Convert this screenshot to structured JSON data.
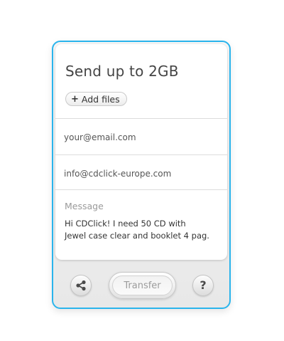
{
  "panel": {
    "title": "Send up to 2GB",
    "add_files_label": "Add files",
    "add_files_icon": "plus-icon"
  },
  "form": {
    "to_email_placeholder": "your@email.com",
    "from_email_value": "info@cdclick-europe.com",
    "message_label": "Message",
    "message_lines": [
      "Hi CDClick! I need 50 CD with",
      "Jewel case clear and booklet 4 pag."
    ]
  },
  "footer": {
    "share_icon": "share-icon",
    "transfer_label": "Transfer",
    "help_glyph": "?",
    "help_icon": "help-icon"
  },
  "colors": {
    "accent_border": "#2ab4ec",
    "text_primary": "#444444",
    "text_muted": "#9a9a9a"
  }
}
